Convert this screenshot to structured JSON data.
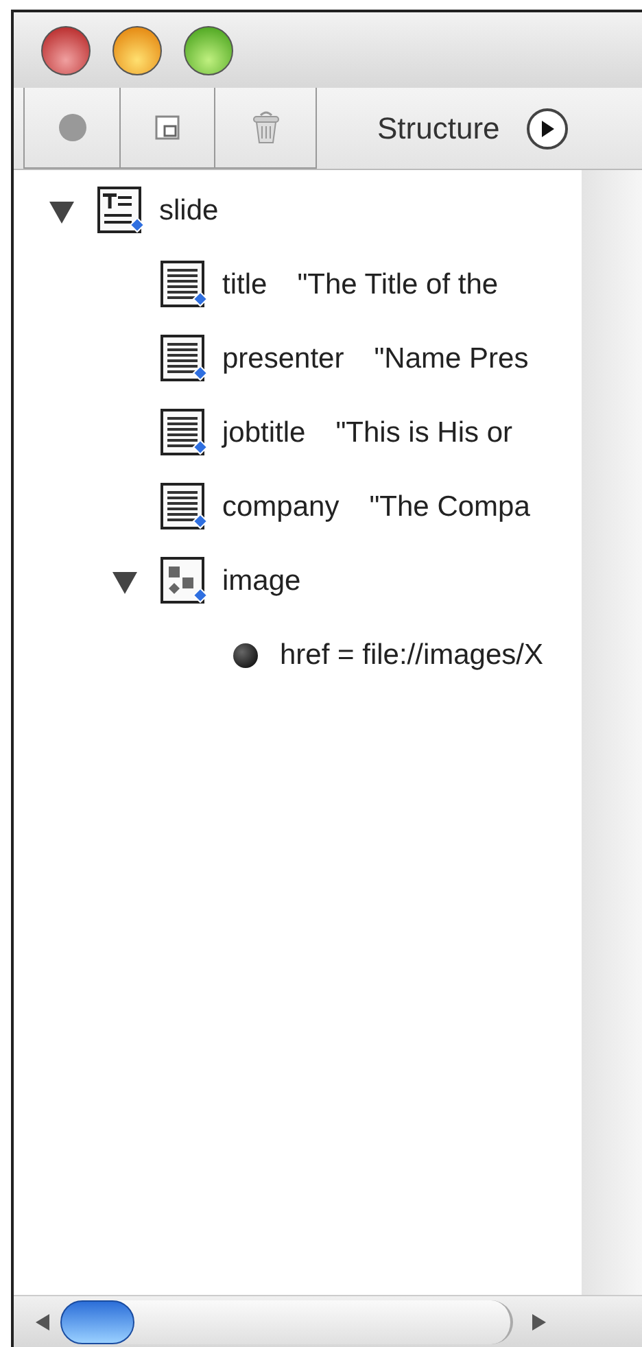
{
  "toolbar": {
    "label": "Structure"
  },
  "tree": [
    {
      "name": "slide",
      "kind": "container",
      "expanded": true,
      "children": [
        {
          "name": "title",
          "value": "\"The Title of the",
          "kind": "text"
        },
        {
          "name": "presenter",
          "value": "\"Name Pres",
          "kind": "text"
        },
        {
          "name": "jobtitle",
          "value": "\"This is His or",
          "kind": "text"
        },
        {
          "name": "company",
          "value": "\"The Compa",
          "kind": "text"
        },
        {
          "name": "image",
          "kind": "image",
          "expanded": true,
          "children": [
            {
              "name": "href = file://images/X",
              "kind": "attribute"
            }
          ]
        }
      ]
    }
  ]
}
